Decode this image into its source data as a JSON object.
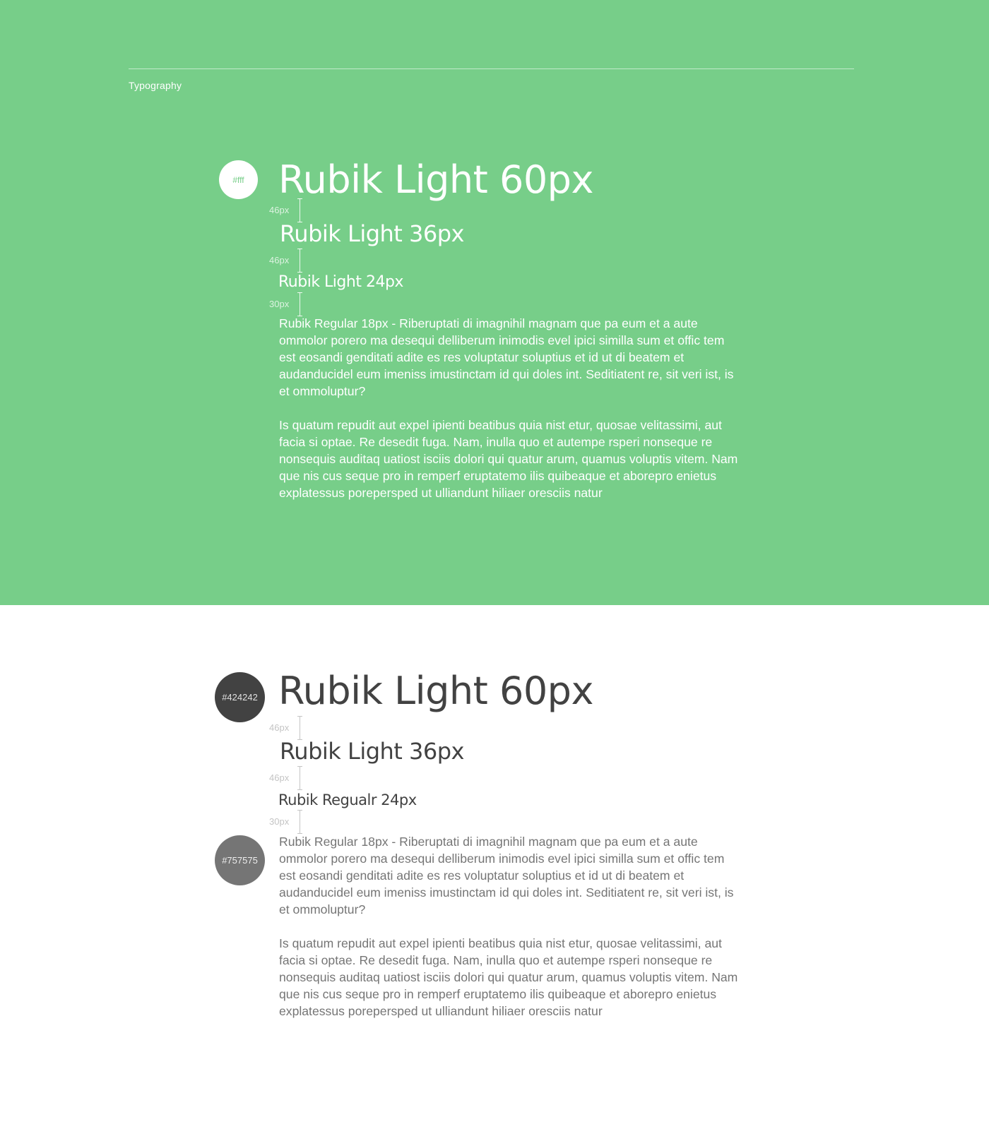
{
  "section_label": "Typography",
  "colors": {
    "green_background": "#77ce89",
    "white_background": "#ffffff",
    "primary_text_dark": "#424242",
    "secondary_text_dark": "#757575",
    "primary_text_light": "#ffffff"
  },
  "light_panel": {
    "swatch_label": "#fff",
    "heading_60": "Rubik Light 60px",
    "heading_36": "Rubik Light 36px",
    "heading_24": "Rubik Light 24px",
    "spacing": [
      "46px",
      "46px",
      "30px"
    ],
    "body_p1": "Rubik Regular 18px - Riberuptati di imagnihil magnam que pa eum et a aute ommolor porero ma desequi delliberum inimodis evel ipici similla sum et offic tem est eosandi genditati adite es res voluptatur soluptius et id ut di beatem  et audanducidel eum imeniss imustinctam id qui doles int. Seditiatent re, sit veri ist, is et ommoluptur?",
    "body_p2": "Is quatum repudit aut expel ipienti beatibus quia nist etur, quosae velitassimi, aut facia si optae.  Re desedit fuga. Nam, inulla quo et autempe rsperi nonseque re nonsequis auditaq uatiost isciis dolori qui quatur arum, quamus voluptis vitem. Nam que nis cus seque pro in remperf eruptatemo ilis quibeaque et aborepro enietus explatessus porepersped ut ulliandunt hiliaer oresciis natur"
  },
  "dark_panel": {
    "swatch_primary_label": "#424242",
    "swatch_secondary_label": "#757575",
    "heading_60": "Rubik Light 60px",
    "heading_36": "Rubik Light 36px",
    "heading_24": "Rubik Regualr 24px",
    "spacing": [
      "46px",
      "46px",
      "30px"
    ],
    "body_p1": "Rubik Regular 18px - Riberuptati di imagnihil magnam que pa eum et a aute ommolor porero ma desequi delliberum inimodis evel ipici similla sum et offic tem est eosandi genditati adite es res voluptatur soluptius et id ut di beatem  et audanducidel eum imeniss imustinctam id qui doles int. Seditiatent re, sit veri ist, is et ommoluptur?",
    "body_p2": "Is quatum repudit aut expel ipienti beatibus quia nist etur, quosae velitassimi, aut facia si optae.  Re desedit fuga. Nam, inulla quo et autempe rsperi nonseque re nonsequis auditaq uatiost isciis dolori qui quatur arum, quamus voluptis vitem. Nam que nis cus seque pro in remperf eruptatemo ilis quibeaque et aborepro enietus explatessus porepersped ut ulliandunt hiliaer oresciis natur"
  }
}
